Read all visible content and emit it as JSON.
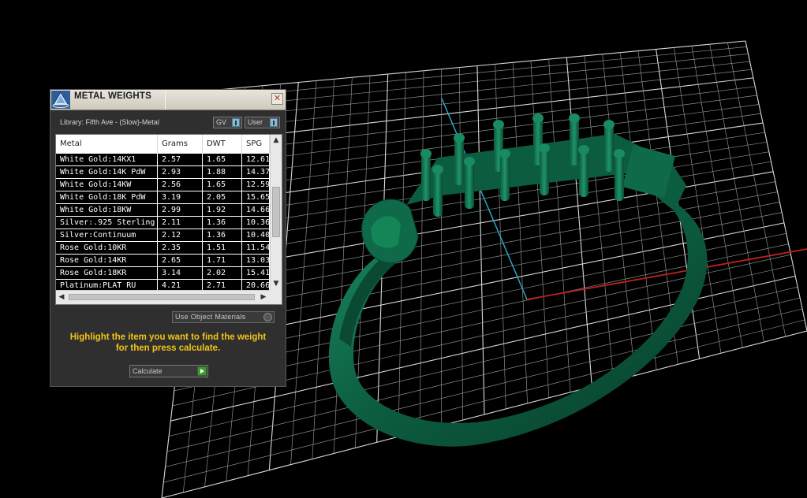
{
  "panel": {
    "title": "METAL WEIGHTS",
    "close_glyph": "✕",
    "library_label": "Library: Fifth Ave - (Slow)-Metal",
    "toggle_gv_label": "GV",
    "toggle_user_label": "User",
    "columns": [
      "Metal",
      "Grams",
      "DWT",
      "SPG"
    ],
    "rows": [
      [
        "White Gold:14KX1",
        "2.57",
        "1.65",
        "12.61"
      ],
      [
        "White Gold:14K PdW",
        "2.93",
        "1.88",
        "14.37"
      ],
      [
        "White Gold:14KW",
        "2.56",
        "1.65",
        "12.59"
      ],
      [
        "White Gold:18K PdW",
        "3.19",
        "2.05",
        "15.65"
      ],
      [
        "White Gold:18KW",
        "2.99",
        "1.92",
        "14.66"
      ],
      [
        "Silver:.925 Sterling",
        "2.11",
        "1.36",
        "10.36"
      ],
      [
        "Silver:Continuum",
        "2.12",
        "1.36",
        "10.40"
      ],
      [
        "Rose Gold:10KR",
        "2.35",
        "1.51",
        "11.54"
      ],
      [
        "Rose Gold:14KR",
        "2.65",
        "1.71",
        "13.03"
      ],
      [
        "Rose Gold:18KR",
        "3.14",
        "2.02",
        "15.41"
      ],
      [
        "Platinum:PLAT RU",
        "4.21",
        "2.71",
        "20.66"
      ]
    ],
    "use_object_materials_label": "Use Object Materials",
    "hint_line1": "Highlight the item you want to find the weight",
    "hint_line2": "for then press calculate.",
    "calculate_label": "Calculate"
  },
  "icons": {
    "logo": "pyramid-logo-icon",
    "close": "close-icon",
    "scroll_up": "chevron-up-icon",
    "scroll_down": "chevron-down-icon",
    "scroll_left": "chevron-left-icon",
    "scroll_right": "chevron-right-icon",
    "calculate": "play-icon"
  },
  "colors": {
    "hint": "#f2c417",
    "model": "#0f6a4a",
    "grid": "#bfbfbf",
    "axis_x": "#c02020",
    "axis_y": "#2aa7c7"
  }
}
